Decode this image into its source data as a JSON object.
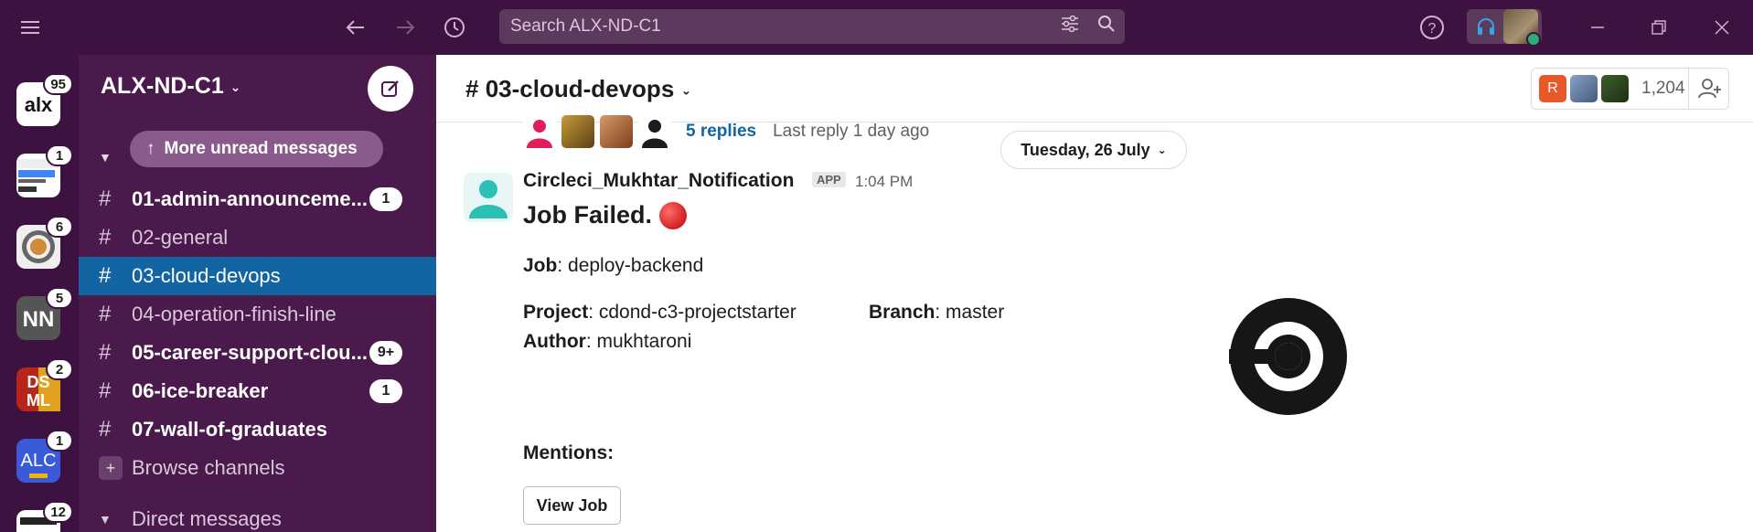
{
  "topbar": {
    "search_placeholder": "Search ALX-ND-C1",
    "colors": {
      "background": "#3d1140"
    }
  },
  "rail": {
    "workspaces": [
      {
        "name": "alx",
        "badge": "95"
      },
      {
        "name": "google-developers",
        "badge": "1"
      },
      {
        "name": "q-workspace",
        "badge": "6"
      },
      {
        "name": "nn-workspace",
        "badge": "5"
      },
      {
        "name": "dsml-workspace",
        "badge": "2"
      },
      {
        "name": "alc-workspace",
        "badge": "1"
      },
      {
        "name": "deep-workspace",
        "badge": "12"
      }
    ]
  },
  "sidebar": {
    "workspace_title": "ALX-ND-C1",
    "more_unread": "More unread messages",
    "channels": [
      {
        "name": "01-admin-announceme...",
        "unread": "1",
        "bold": true
      },
      {
        "name": "02-general",
        "unread": "",
        "bold": false
      },
      {
        "name": "03-cloud-devops",
        "unread": "",
        "bold": false,
        "active": true
      },
      {
        "name": "04-operation-finish-line",
        "unread": "",
        "bold": false
      },
      {
        "name": "05-career-support-clou...",
        "unread": "9+",
        "bold": true
      },
      {
        "name": "06-ice-breaker",
        "unread": "1",
        "bold": true
      },
      {
        "name": "07-wall-of-graduates",
        "unread": "",
        "bold": true
      }
    ],
    "browse_channels": "Browse channels",
    "direct_messages": "Direct messages"
  },
  "main": {
    "channel_name": "03-cloud-devops",
    "member_count": "1,204",
    "member_initial": "R",
    "thread": {
      "replies": "5 replies",
      "last_reply": "Last reply 1 day ago"
    },
    "date_divider": "Tuesday, 26 July",
    "message": {
      "sender": "Circleci_Mukhtar_Notification",
      "app_tag": "APP",
      "time": "1:04 PM",
      "headline": "Job Failed.",
      "job_label": "Job",
      "job_value": "deploy-backend",
      "project_label": "Project",
      "project_value": "cdond-c3-projectstarter",
      "branch_label": "Branch",
      "branch_value": "master",
      "author_label": "Author",
      "author_value": "mukhtaroni",
      "mentions_label": "Mentions:",
      "view_job": "View Job"
    }
  }
}
